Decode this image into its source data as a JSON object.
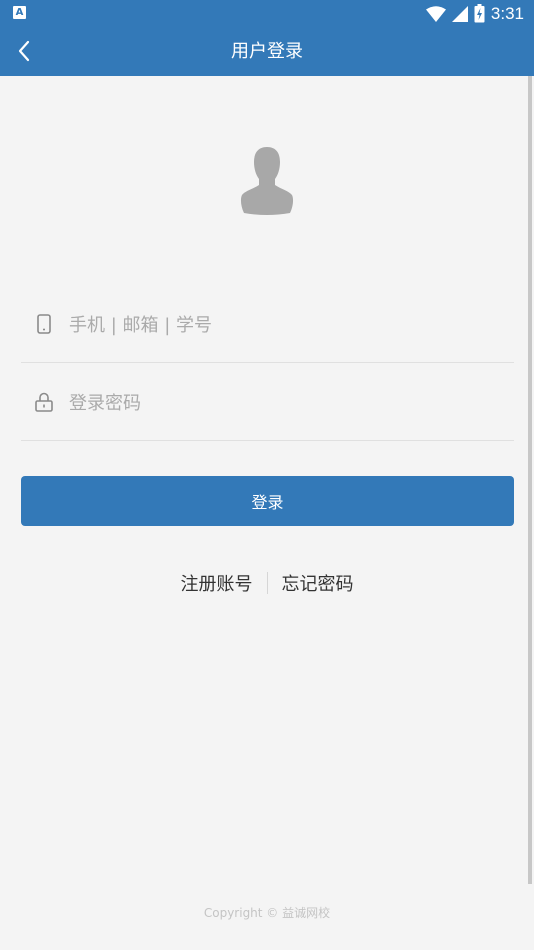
{
  "status_bar": {
    "app_badge": "A",
    "time": "3:31",
    "icons": [
      "wifi-icon",
      "signal-icon",
      "battery-charging-icon"
    ]
  },
  "app_bar": {
    "title": "用户登录",
    "back_icon": "chevron-left-icon"
  },
  "avatar_icon": "user-silhouette-icon",
  "form": {
    "account": {
      "icon": "phone-icon",
      "placeholder": "手机 | 邮箱 | 学号",
      "value": ""
    },
    "password": {
      "icon": "lock-icon",
      "placeholder": "登录密码",
      "value": ""
    },
    "login_label": "登录"
  },
  "links": {
    "register_label": "注册账号",
    "forgot_label": "忘记密码"
  },
  "footer": {
    "copyright": "Copyright © 益诚网校"
  },
  "colors": {
    "primary": "#3379b8",
    "background": "#f4f4f4",
    "placeholder": "#aaaaaa",
    "divider": "#e0e0e0"
  }
}
